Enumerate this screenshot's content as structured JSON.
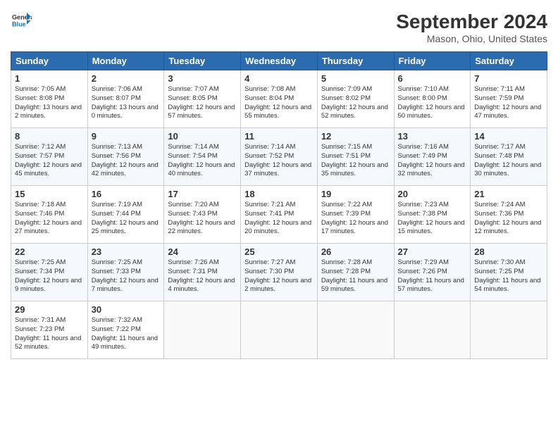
{
  "header": {
    "logo_line1": "General",
    "logo_line2": "Blue",
    "month_title": "September 2024",
    "location": "Mason, Ohio, United States"
  },
  "weekdays": [
    "Sunday",
    "Monday",
    "Tuesday",
    "Wednesday",
    "Thursday",
    "Friday",
    "Saturday"
  ],
  "weeks": [
    [
      {
        "day": "1",
        "sunrise": "Sunrise: 7:05 AM",
        "sunset": "Sunset: 8:08 PM",
        "daylight": "Daylight: 13 hours and 2 minutes."
      },
      {
        "day": "2",
        "sunrise": "Sunrise: 7:06 AM",
        "sunset": "Sunset: 8:07 PM",
        "daylight": "Daylight: 13 hours and 0 minutes."
      },
      {
        "day": "3",
        "sunrise": "Sunrise: 7:07 AM",
        "sunset": "Sunset: 8:05 PM",
        "daylight": "Daylight: 12 hours and 57 minutes."
      },
      {
        "day": "4",
        "sunrise": "Sunrise: 7:08 AM",
        "sunset": "Sunset: 8:04 PM",
        "daylight": "Daylight: 12 hours and 55 minutes."
      },
      {
        "day": "5",
        "sunrise": "Sunrise: 7:09 AM",
        "sunset": "Sunset: 8:02 PM",
        "daylight": "Daylight: 12 hours and 52 minutes."
      },
      {
        "day": "6",
        "sunrise": "Sunrise: 7:10 AM",
        "sunset": "Sunset: 8:00 PM",
        "daylight": "Daylight: 12 hours and 50 minutes."
      },
      {
        "day": "7",
        "sunrise": "Sunrise: 7:11 AM",
        "sunset": "Sunset: 7:59 PM",
        "daylight": "Daylight: 12 hours and 47 minutes."
      }
    ],
    [
      {
        "day": "8",
        "sunrise": "Sunrise: 7:12 AM",
        "sunset": "Sunset: 7:57 PM",
        "daylight": "Daylight: 12 hours and 45 minutes."
      },
      {
        "day": "9",
        "sunrise": "Sunrise: 7:13 AM",
        "sunset": "Sunset: 7:56 PM",
        "daylight": "Daylight: 12 hours and 42 minutes."
      },
      {
        "day": "10",
        "sunrise": "Sunrise: 7:14 AM",
        "sunset": "Sunset: 7:54 PM",
        "daylight": "Daylight: 12 hours and 40 minutes."
      },
      {
        "day": "11",
        "sunrise": "Sunrise: 7:14 AM",
        "sunset": "Sunset: 7:52 PM",
        "daylight": "Daylight: 12 hours and 37 minutes."
      },
      {
        "day": "12",
        "sunrise": "Sunrise: 7:15 AM",
        "sunset": "Sunset: 7:51 PM",
        "daylight": "Daylight: 12 hours and 35 minutes."
      },
      {
        "day": "13",
        "sunrise": "Sunrise: 7:16 AM",
        "sunset": "Sunset: 7:49 PM",
        "daylight": "Daylight: 12 hours and 32 minutes."
      },
      {
        "day": "14",
        "sunrise": "Sunrise: 7:17 AM",
        "sunset": "Sunset: 7:48 PM",
        "daylight": "Daylight: 12 hours and 30 minutes."
      }
    ],
    [
      {
        "day": "15",
        "sunrise": "Sunrise: 7:18 AM",
        "sunset": "Sunset: 7:46 PM",
        "daylight": "Daylight: 12 hours and 27 minutes."
      },
      {
        "day": "16",
        "sunrise": "Sunrise: 7:19 AM",
        "sunset": "Sunset: 7:44 PM",
        "daylight": "Daylight: 12 hours and 25 minutes."
      },
      {
        "day": "17",
        "sunrise": "Sunrise: 7:20 AM",
        "sunset": "Sunset: 7:43 PM",
        "daylight": "Daylight: 12 hours and 22 minutes."
      },
      {
        "day": "18",
        "sunrise": "Sunrise: 7:21 AM",
        "sunset": "Sunset: 7:41 PM",
        "daylight": "Daylight: 12 hours and 20 minutes."
      },
      {
        "day": "19",
        "sunrise": "Sunrise: 7:22 AM",
        "sunset": "Sunset: 7:39 PM",
        "daylight": "Daylight: 12 hours and 17 minutes."
      },
      {
        "day": "20",
        "sunrise": "Sunrise: 7:23 AM",
        "sunset": "Sunset: 7:38 PM",
        "daylight": "Daylight: 12 hours and 15 minutes."
      },
      {
        "day": "21",
        "sunrise": "Sunrise: 7:24 AM",
        "sunset": "Sunset: 7:36 PM",
        "daylight": "Daylight: 12 hours and 12 minutes."
      }
    ],
    [
      {
        "day": "22",
        "sunrise": "Sunrise: 7:25 AM",
        "sunset": "Sunset: 7:34 PM",
        "daylight": "Daylight: 12 hours and 9 minutes."
      },
      {
        "day": "23",
        "sunrise": "Sunrise: 7:25 AM",
        "sunset": "Sunset: 7:33 PM",
        "daylight": "Daylight: 12 hours and 7 minutes."
      },
      {
        "day": "24",
        "sunrise": "Sunrise: 7:26 AM",
        "sunset": "Sunset: 7:31 PM",
        "daylight": "Daylight: 12 hours and 4 minutes."
      },
      {
        "day": "25",
        "sunrise": "Sunrise: 7:27 AM",
        "sunset": "Sunset: 7:30 PM",
        "daylight": "Daylight: 12 hours and 2 minutes."
      },
      {
        "day": "26",
        "sunrise": "Sunrise: 7:28 AM",
        "sunset": "Sunset: 7:28 PM",
        "daylight": "Daylight: 11 hours and 59 minutes."
      },
      {
        "day": "27",
        "sunrise": "Sunrise: 7:29 AM",
        "sunset": "Sunset: 7:26 PM",
        "daylight": "Daylight: 11 hours and 57 minutes."
      },
      {
        "day": "28",
        "sunrise": "Sunrise: 7:30 AM",
        "sunset": "Sunset: 7:25 PM",
        "daylight": "Daylight: 11 hours and 54 minutes."
      }
    ],
    [
      {
        "day": "29",
        "sunrise": "Sunrise: 7:31 AM",
        "sunset": "Sunset: 7:23 PM",
        "daylight": "Daylight: 11 hours and 52 minutes."
      },
      {
        "day": "30",
        "sunrise": "Sunrise: 7:32 AM",
        "sunset": "Sunset: 7:22 PM",
        "daylight": "Daylight: 11 hours and 49 minutes."
      },
      null,
      null,
      null,
      null,
      null
    ]
  ]
}
